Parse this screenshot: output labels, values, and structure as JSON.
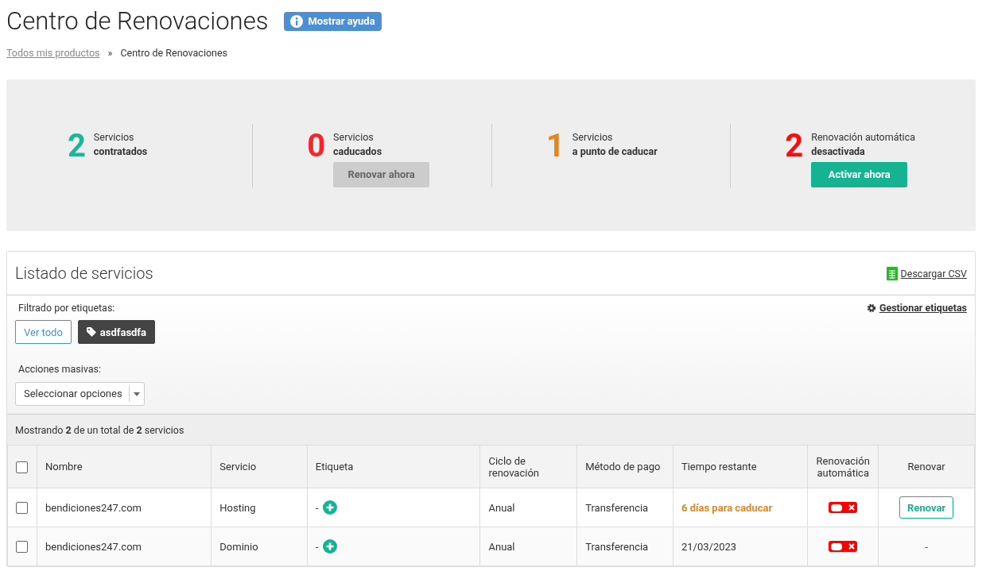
{
  "page_title": "Centro de Renovaciones",
  "help_button": "Mostrar ayuda",
  "breadcrumb": [
    {
      "label": "Todos mis productos",
      "link": true
    },
    {
      "label": "»",
      "link": false
    },
    {
      "label": "Centro de Renovaciones",
      "link": false
    }
  ],
  "stats": [
    {
      "number": "2",
      "color": "#1fb597",
      "line1": "Servicios",
      "line2": "contratados"
    },
    {
      "number": "0",
      "color": "#f4262b",
      "line1": "Servicios",
      "line2": "caducados",
      "button": {
        "label": "Renovar ahora",
        "disabled": true
      }
    },
    {
      "number": "1",
      "color": "#e5861a",
      "line1": "Servicios",
      "line2": "a punto de caducar"
    },
    {
      "number": "2",
      "color": "#f60f0f",
      "line1": "Renovación automática",
      "line2": "desactivada",
      "button": {
        "label": "Activar ahora",
        "disabled": false
      }
    }
  ],
  "list": {
    "title": "Listado de servicios",
    "download": "Descargar CSV",
    "filter_label": "Filtrado por etiquetas:",
    "manage_tags": "Gestionar etiquetas",
    "filters": [
      {
        "label": "Ver todo",
        "selected": false,
        "kind": "all"
      },
      {
        "label": "asdfasdfa",
        "selected": true,
        "kind": "tag"
      }
    ],
    "bulk_label": "Acciones masivas:",
    "bulk_select": "Seleccionar opciones",
    "summary": "Mostrando **2** de un total de **2** servicios"
  },
  "table": {
    "columns": [
      "Nombre",
      "Servicio",
      "Etiqueta",
      "Ciclo de renovación",
      "Método de pago",
      "Tiempo restante",
      "Renovación automática",
      "Renovar"
    ],
    "all_checked": false,
    "rows": [
      {
        "checked": false,
        "name": "bendiciones247.com",
        "service": "Hosting",
        "tag": "-",
        "cycle": "Anual",
        "payment": "Transferencia",
        "remaining": "6 días para caducar",
        "urgent": true,
        "auto_renew": false,
        "renew": {
          "kind": "button",
          "label": "Renovar"
        }
      },
      {
        "checked": false,
        "name": "bendiciones247.com",
        "service": "Dominio",
        "tag": "-",
        "cycle": "Anual",
        "payment": "Transferencia",
        "remaining": "21/03/2023",
        "urgent": false,
        "auto_renew": false,
        "renew": {
          "kind": "text",
          "label": "-"
        }
      }
    ]
  }
}
